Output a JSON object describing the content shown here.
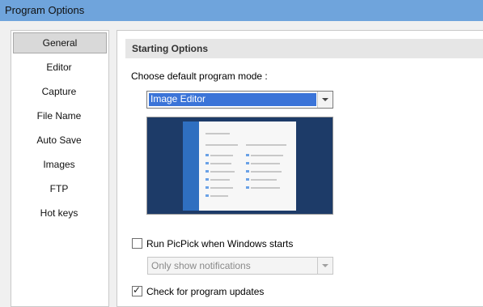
{
  "window": {
    "title": "Program Options"
  },
  "sidebar": {
    "items": [
      {
        "label": "General",
        "active": true
      },
      {
        "label": "Editor"
      },
      {
        "label": "Capture"
      },
      {
        "label": "File Name"
      },
      {
        "label": "Auto Save"
      },
      {
        "label": "Images"
      },
      {
        "label": "FTP"
      },
      {
        "label": "Hot keys"
      }
    ]
  },
  "main": {
    "section_title": "Starting Options",
    "mode_label": "Choose default program mode :",
    "mode_value": "Image Editor",
    "run_on_start_label": "Run PicPick when Windows starts",
    "run_on_start_checked": false,
    "startup_mode_value": "Only show notifications",
    "check_updates_label": "Check for program updates",
    "check_updates_checked": true
  },
  "colors": {
    "titlebar": "#6fa4dc",
    "selection": "#3b74d8",
    "preview_bg": "#1d3b68"
  }
}
